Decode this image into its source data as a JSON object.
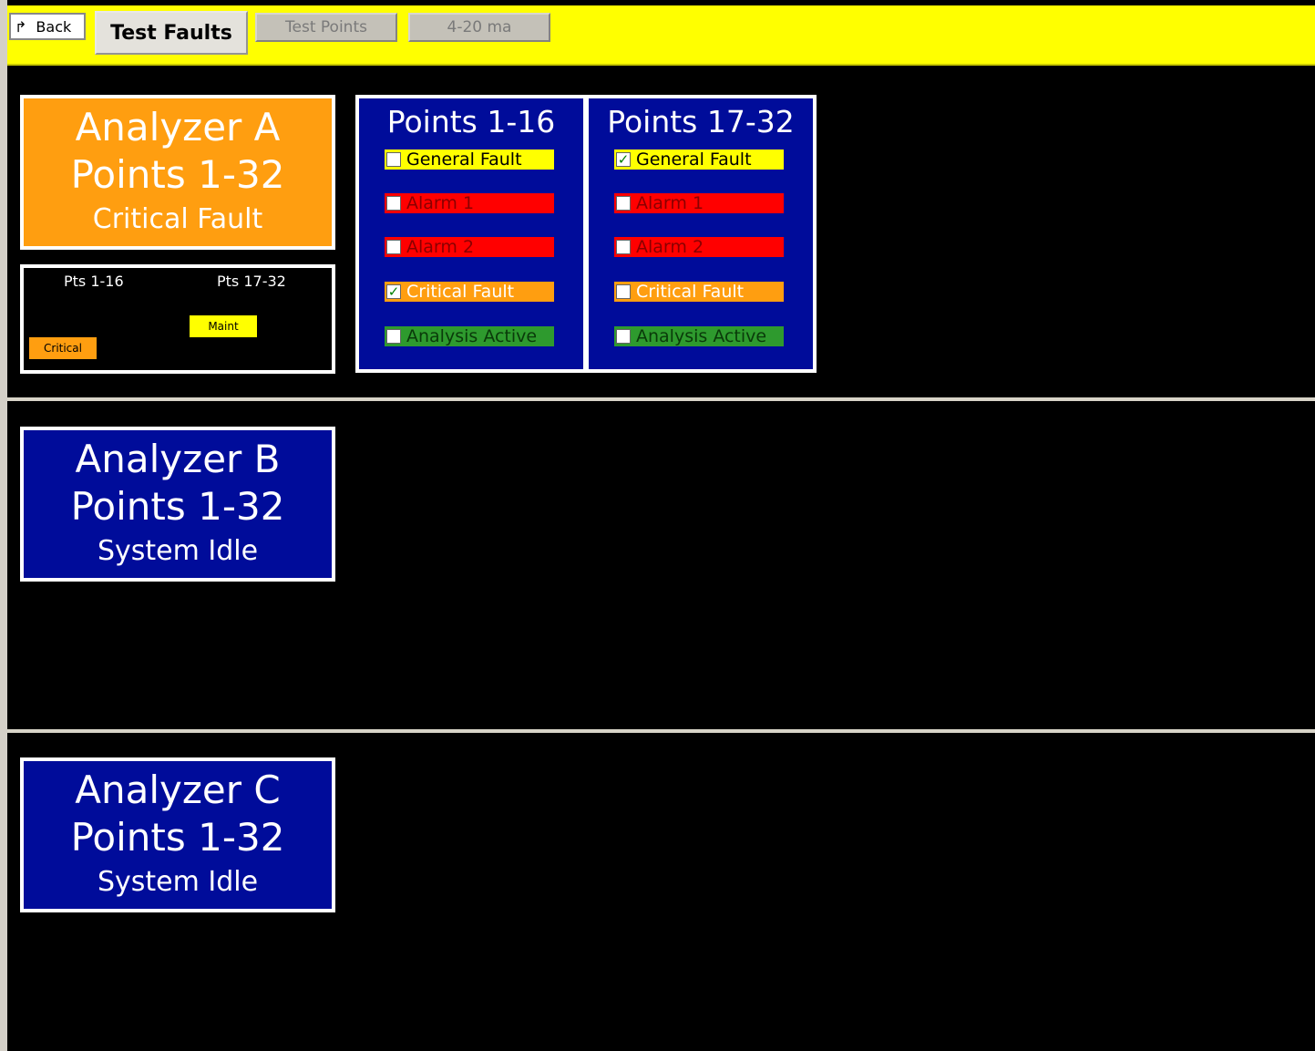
{
  "toolbar": {
    "back_label": "Back",
    "back_icon": "return-arrow-icon",
    "test_faults_label": "Test Faults",
    "test_points_label": "Test Points",
    "ma_label": "4-20 ma"
  },
  "analyzers": {
    "a": {
      "line1": "Analyzer A",
      "line2": "Points 1-32",
      "status": "Critical Fault",
      "color": "#ff9e10"
    },
    "b": {
      "line1": "Analyzer B",
      "line2": "Points 1-32",
      "status": "System Idle",
      "color": "#000c9a"
    },
    "c": {
      "line1": "Analyzer C",
      "line2": "Points 1-32",
      "status": "System Idle",
      "color": "#000c9a"
    }
  },
  "summary": {
    "left_label": "Pts 1-16",
    "right_label": "Pts 17-32",
    "maint_tag": "Maint",
    "critical_tag": "Critical"
  },
  "points": {
    "col1": {
      "title": "Points 1-16",
      "flags": [
        {
          "label": "General Fault",
          "checked": false
        },
        {
          "label": "Alarm 1",
          "checked": false
        },
        {
          "label": "Alarm 2",
          "checked": false
        },
        {
          "label": "Critical Fault",
          "checked": true
        },
        {
          "label": "Analysis Active",
          "checked": false
        }
      ]
    },
    "col2": {
      "title": "Points 17-32",
      "flags": [
        {
          "label": "General Fault",
          "checked": true
        },
        {
          "label": "Alarm 1",
          "checked": false
        },
        {
          "label": "Alarm 2",
          "checked": false
        },
        {
          "label": "Critical Fault",
          "checked": false
        },
        {
          "label": "Analysis Active",
          "checked": false
        }
      ]
    }
  },
  "colors": {
    "toolbar": "#ffff00",
    "general_fault": "#ffff00",
    "alarm": "#ff0000",
    "critical_fault": "#ff9e10",
    "analysis_active": "#2e9a2e",
    "panel": "#000c9a"
  }
}
